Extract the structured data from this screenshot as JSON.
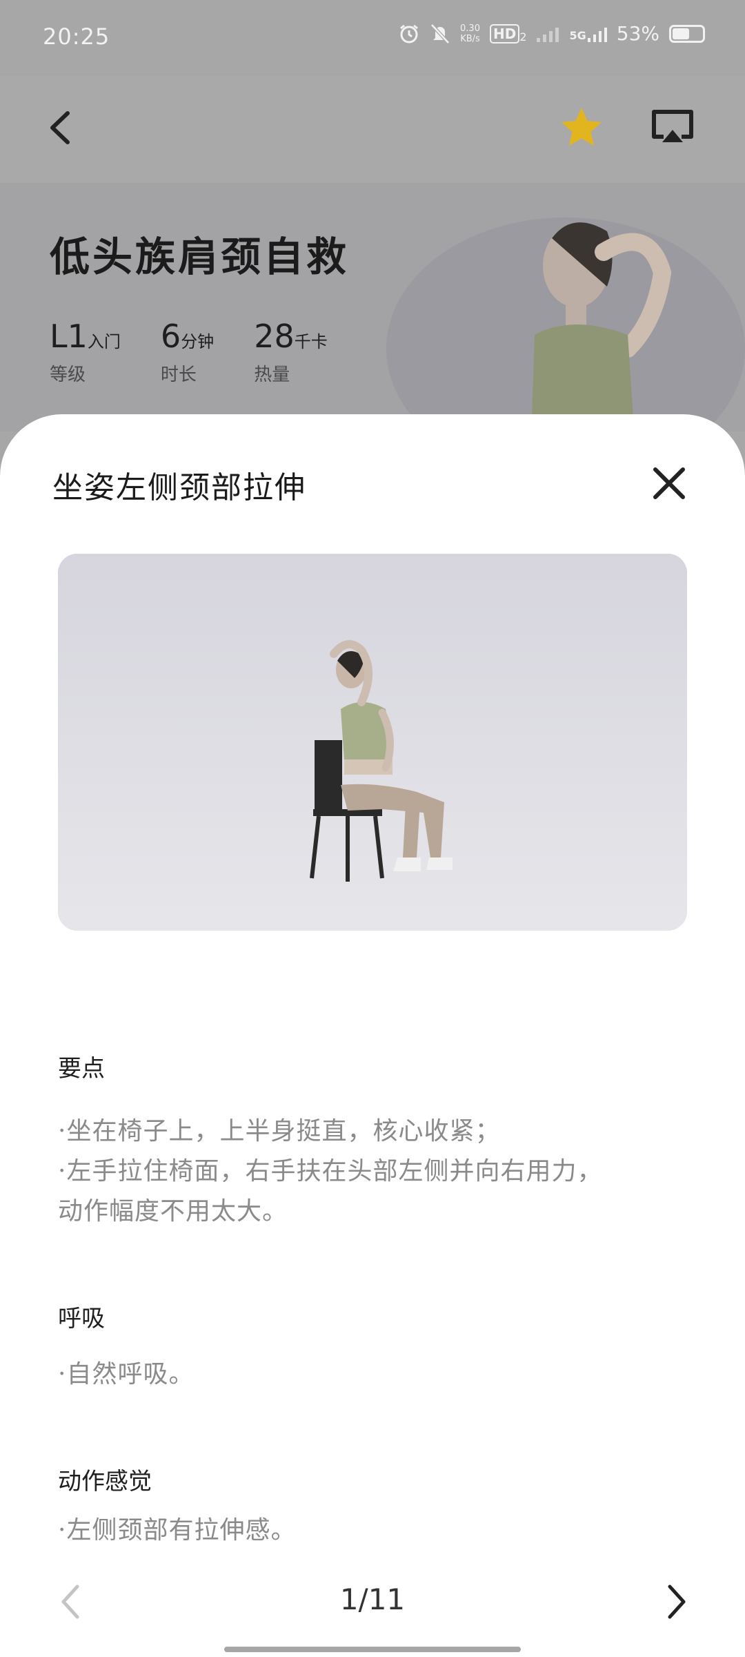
{
  "status_bar": {
    "time": "20:25",
    "net_speed_value": "0.30",
    "net_speed_unit": "KB/s",
    "hd_label": "HD",
    "hd_sub": "2",
    "network": "5G",
    "battery": "53%"
  },
  "hero": {
    "title": "低头族肩颈自救",
    "stats": [
      {
        "value": "L1",
        "unit": "入门",
        "label": "等级"
      },
      {
        "value": "6",
        "unit": "分钟",
        "label": "时长"
      },
      {
        "value": "28",
        "unit": "千卡",
        "label": "热量"
      }
    ]
  },
  "sheet": {
    "title": "坐姿左侧颈部拉伸",
    "sections": [
      {
        "heading": "要点",
        "lines": [
          "·坐在椅子上，上半身挺直，核心收紧；",
          "·左手拉住椅面，右手扶在头部左侧并向右用力，",
          "动作幅度不用太大。"
        ]
      },
      {
        "heading": "呼吸",
        "lines": [
          "·自然呼吸。"
        ]
      },
      {
        "heading": "动作感觉",
        "lines": [
          "·左侧颈部有拉伸感。"
        ]
      }
    ],
    "pager": {
      "current": "1/11"
    }
  },
  "colors": {
    "star": "#e2b51f",
    "sheet_bg": "#ffffff",
    "scrim": "#a7a7a7"
  },
  "icons": {
    "back": "chevron-left-icon",
    "favorite": "star-icon",
    "cast": "screen-cast-icon",
    "close": "close-icon",
    "prev": "chevron-left-icon",
    "next": "chevron-right-icon"
  }
}
